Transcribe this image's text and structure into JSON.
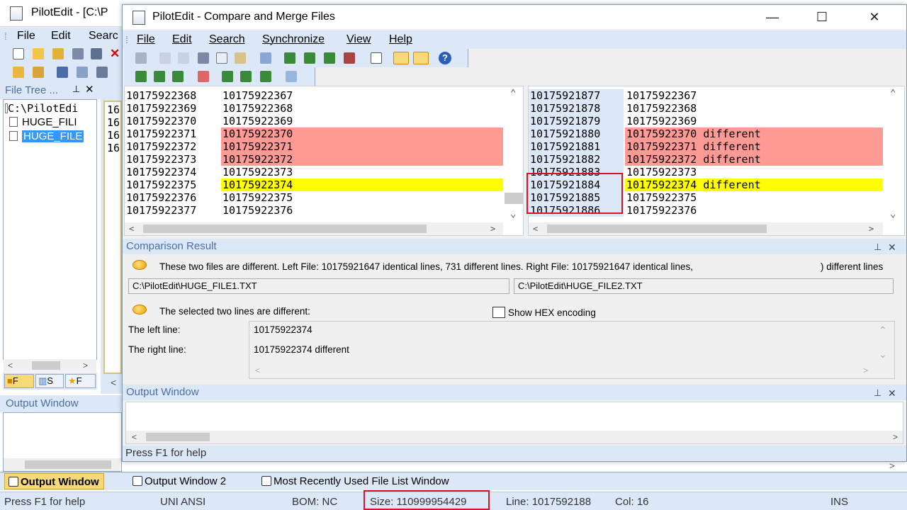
{
  "main": {
    "title": "PilotEdit - [C:\\P",
    "menu": [
      "File",
      "Edit",
      "Searc"
    ],
    "file_tree": {
      "title": "File Tree ...",
      "items": [
        "C:\\PilotEdi",
        "HUGE_FILI",
        "HUGE_FILE"
      ],
      "tabs": [
        "F",
        "S",
        "F"
      ]
    },
    "editor_stub_lines": [
      "16",
      "16",
      "16",
      "16"
    ],
    "output_window": {
      "title": "Output Window"
    },
    "bottom_tabs": [
      "Output Window",
      "Output Window 2",
      "Most Recently Used File List Window"
    ],
    "status": {
      "help": "Press F1 for help",
      "encoding": "UNI ANSI",
      "bom": "BOM: NC",
      "size": "Size: 110999954429",
      "line": "Line: 1017592188",
      "col": "Col: 16",
      "mode": "INS"
    }
  },
  "dialog": {
    "title": "PilotEdit - Compare and Merge Files",
    "menu": [
      "File",
      "Edit",
      "Search",
      "Synchronize",
      "View",
      "Help"
    ],
    "left_pane": {
      "rows": [
        {
          "num": "10175922368",
          "text": "10175922367",
          "state": "same"
        },
        {
          "num": "10175922369",
          "text": "10175922368",
          "state": "same"
        },
        {
          "num": "10175922370",
          "text": "10175922369",
          "state": "same"
        },
        {
          "num": "10175922371",
          "text": "10175922370",
          "state": "diff"
        },
        {
          "num": "10175922372",
          "text": "10175922371",
          "state": "diff"
        },
        {
          "num": "10175922373",
          "text": "10175922372",
          "state": "diff"
        },
        {
          "num": "10175922374",
          "text": "10175922373",
          "state": "same"
        },
        {
          "num": "10175922375",
          "text": "10175922374",
          "state": "selected"
        },
        {
          "num": "10175922376",
          "text": "10175922375",
          "state": "same"
        },
        {
          "num": "10175922377",
          "text": "10175922376",
          "state": "same"
        }
      ]
    },
    "right_pane": {
      "rows": [
        {
          "num": "10175921877",
          "text": "10175922367",
          "state": "same"
        },
        {
          "num": "10175921878",
          "text": "10175922368",
          "state": "same"
        },
        {
          "num": "10175921879",
          "text": "10175922369",
          "state": "same"
        },
        {
          "num": "10175921880",
          "text": "10175922370 different",
          "state": "diff"
        },
        {
          "num": "10175921881",
          "text": "10175922371 different",
          "state": "diff"
        },
        {
          "num": "10175921882",
          "text": "10175922372 different",
          "state": "diff"
        },
        {
          "num": "10175921883",
          "text": "10175922373",
          "state": "same"
        },
        {
          "num": "10175921884",
          "text": "10175922374 different",
          "state": "selected"
        },
        {
          "num": "10175921885",
          "text": "10175922375",
          "state": "same"
        },
        {
          "num": "10175921886",
          "text": "10175922376",
          "state": "same"
        }
      ]
    },
    "comparison_result": {
      "title": "Comparison Result",
      "summary": "These two files are different. Left File: 10175921647 identical lines, 731 different lines. Right File: 10175921647 identical lines,",
      "summary_tail": ") different lines",
      "left_file": "C:\\PilotEdit\\HUGE_FILE1.TXT",
      "right_file": "C:\\PilotEdit\\HUGE_FILE2.TXT",
      "selected_msg": "The selected two lines are different:",
      "hex_label": "Show HEX encoding",
      "hex_checked": false,
      "left_line_label": "The left line:",
      "right_line_label": "The right line:",
      "left_line_value": "10175922374",
      "right_line_value": "10175922374 different"
    },
    "output_window": {
      "title": "Output Window"
    },
    "status": "Press F1 for help"
  },
  "colors": {
    "diff_bg": "#ff9a94",
    "selected_bg": "#ffff00",
    "panel_bg": "#dce8f8",
    "highlight_border": "#e01020"
  }
}
